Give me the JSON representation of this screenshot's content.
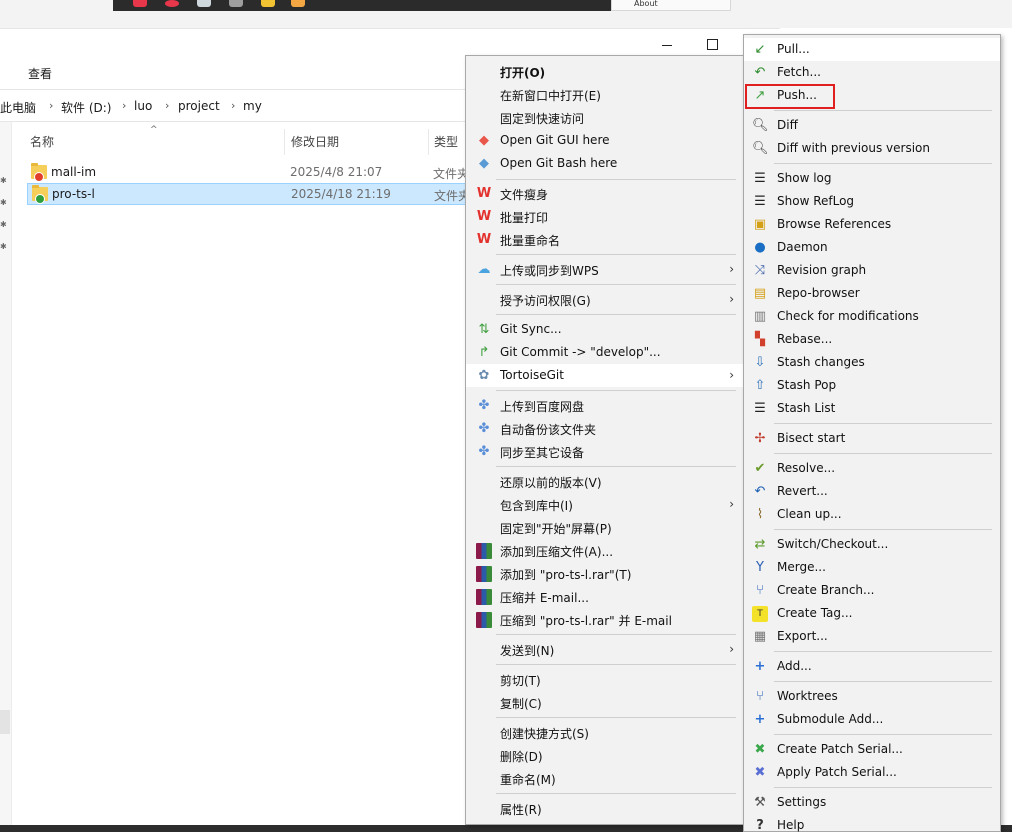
{
  "background_window": {
    "about_label": "About"
  },
  "explorer": {
    "ribbon": {
      "view_tab": "查看"
    },
    "breadcrumb": [
      "此电脑",
      "软件 (D:)",
      "luo",
      "project",
      "my"
    ],
    "columns": {
      "name": "名称",
      "modified": "修改日期",
      "type": "类型"
    },
    "files": [
      {
        "name": "mall-im",
        "modified": "2025/4/8 21:07",
        "type": "文件夹",
        "status": "conflict"
      },
      {
        "name": "pro-ts-l",
        "modified": "2025/4/18 21:19",
        "type": "文件夹",
        "status": "normal"
      }
    ]
  },
  "context_menu": {
    "items": [
      {
        "label": "打开(O)",
        "icon": "none",
        "bold": true
      },
      {
        "label": "在新窗口中打开(E)",
        "icon": "none"
      },
      {
        "label": "固定到快速访问",
        "icon": "none"
      },
      {
        "label": "Open Git GUI here",
        "icon": "git-diamond-icon"
      },
      {
        "label": "Open Git Bash here",
        "icon": "git-diamond-icon"
      },
      {
        "label": "文件瘦身",
        "icon": "wps-icon"
      },
      {
        "label": "批量打印",
        "icon": "wps-icon"
      },
      {
        "label": "批量重命名",
        "icon": "wps-icon"
      },
      {
        "label": "上传或同步到WPS",
        "icon": "cloud-icon",
        "submenu": true
      },
      {
        "label": "授予访问权限(G)",
        "icon": "none",
        "submenu": true
      },
      {
        "label": "Git Sync...",
        "icon": "git-sync-icon"
      },
      {
        "label": "Git Commit -> \"develop\"...",
        "icon": "git-commit-icon"
      },
      {
        "label": "TortoiseGit",
        "icon": "tortoisegit-icon",
        "submenu": true,
        "highlighted": true
      },
      {
        "label": "上传到百度网盘",
        "icon": "baidu-icon"
      },
      {
        "label": "自动备份该文件夹",
        "icon": "baidu-icon"
      },
      {
        "label": "同步至其它设备",
        "icon": "baidu-icon"
      },
      {
        "label": "还原以前的版本(V)",
        "icon": "none"
      },
      {
        "label": "包含到库中(I)",
        "icon": "none",
        "submenu": true
      },
      {
        "label": "固定到\"开始\"屏幕(P)",
        "icon": "none"
      },
      {
        "label": "添加到压缩文件(A)...",
        "icon": "winrar-icon"
      },
      {
        "label": "添加到 \"pro-ts-l.rar\"(T)",
        "icon": "winrar-icon"
      },
      {
        "label": "压缩并 E-mail...",
        "icon": "winrar-icon"
      },
      {
        "label": "压缩到 \"pro-ts-l.rar\" 并 E-mail",
        "icon": "winrar-icon"
      },
      {
        "label": "发送到(N)",
        "icon": "none",
        "submenu": true
      },
      {
        "label": "剪切(T)",
        "icon": "none"
      },
      {
        "label": "复制(C)",
        "icon": "none"
      },
      {
        "label": "创建快捷方式(S)",
        "icon": "none"
      },
      {
        "label": "删除(D)",
        "icon": "none"
      },
      {
        "label": "重命名(M)",
        "icon": "none"
      },
      {
        "label": "属性(R)",
        "icon": "none"
      }
    ]
  },
  "tortoisegit_menu": {
    "items": [
      {
        "label": "Pull...",
        "icon": "pull-icon"
      },
      {
        "label": "Fetch...",
        "icon": "fetch-icon"
      },
      {
        "label": "Push...",
        "icon": "push-icon",
        "annotated": true
      },
      {
        "label": "Diff",
        "icon": "diff-icon"
      },
      {
        "label": "Diff with previous version",
        "icon": "diff-icon"
      },
      {
        "label": "Show log",
        "icon": "log-icon"
      },
      {
        "label": "Show RefLog",
        "icon": "log-icon"
      },
      {
        "label": "Browse References",
        "icon": "references-icon"
      },
      {
        "label": "Daemon",
        "icon": "daemon-icon"
      },
      {
        "label": "Revision graph",
        "icon": "revision-graph-icon"
      },
      {
        "label": "Repo-browser",
        "icon": "repo-browser-icon"
      },
      {
        "label": "Check for modifications",
        "icon": "check-modifications-icon"
      },
      {
        "label": "Rebase...",
        "icon": "rebase-icon"
      },
      {
        "label": "Stash changes",
        "icon": "stash-icon"
      },
      {
        "label": "Stash Pop",
        "icon": "stash-pop-icon"
      },
      {
        "label": "Stash List",
        "icon": "log-icon"
      },
      {
        "label": "Bisect start",
        "icon": "bisect-icon"
      },
      {
        "label": "Resolve...",
        "icon": "resolve-icon"
      },
      {
        "label": "Revert...",
        "icon": "revert-icon"
      },
      {
        "label": "Clean up...",
        "icon": "cleanup-icon"
      },
      {
        "label": "Switch/Checkout...",
        "icon": "switch-icon"
      },
      {
        "label": "Merge...",
        "icon": "merge-icon"
      },
      {
        "label": "Create Branch...",
        "icon": "branch-icon"
      },
      {
        "label": "Create Tag...",
        "icon": "tag-icon"
      },
      {
        "label": "Export...",
        "icon": "export-icon"
      },
      {
        "label": "Add...",
        "icon": "add-icon"
      },
      {
        "label": "Worktrees",
        "icon": "worktree-icon"
      },
      {
        "label": "Submodule Add...",
        "icon": "add-icon"
      },
      {
        "label": "Create Patch Serial...",
        "icon": "patch-create-icon"
      },
      {
        "label": "Apply Patch Serial...",
        "icon": "patch-apply-icon"
      },
      {
        "label": "Settings",
        "icon": "settings-icon"
      },
      {
        "label": "Help",
        "icon": "help-icon"
      }
    ]
  },
  "colors": {
    "selection": "#cce8ff",
    "menu_bg": "#f2f2f2",
    "annotation": "#e02020",
    "menu_highlight": "#ffffff"
  }
}
